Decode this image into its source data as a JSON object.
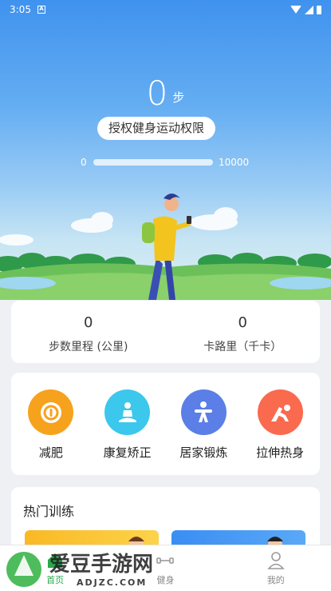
{
  "status_bar": {
    "time": "3:05"
  },
  "hero": {
    "step_value": "0",
    "step_unit": "步",
    "auth_button": "授权健身运动权限",
    "progress": {
      "min_label": "0",
      "max_label": "10000",
      "value": 0
    }
  },
  "stats": {
    "distance": {
      "value": "0",
      "label": "步数里程 (公里)"
    },
    "calories": {
      "value": "0",
      "label": "卡路里（千卡）"
    }
  },
  "categories": [
    {
      "label": "减肥",
      "icon": "scale-icon",
      "color": "#f7a21c"
    },
    {
      "label": "康复矫正",
      "icon": "meditation-icon",
      "color": "#3cc7ec"
    },
    {
      "label": "居家锻炼",
      "icon": "exercise-icon",
      "color": "#5b7fe6"
    },
    {
      "label": "拉伸热身",
      "icon": "stretch-icon",
      "color": "#fa6a4f"
    }
  ],
  "hot_training": {
    "title": "热门训练"
  },
  "bottom_nav": {
    "items": [
      {
        "label": "首页",
        "active": true
      },
      {
        "label": "健身",
        "active": false
      },
      {
        "label": "我的",
        "active": false
      }
    ]
  },
  "watermark": {
    "text": "爱豆手游网",
    "url": "ADJZC.COM"
  },
  "colors": {
    "accent_green": "#2aa84a",
    "sky_blue": "#3f92ee"
  }
}
